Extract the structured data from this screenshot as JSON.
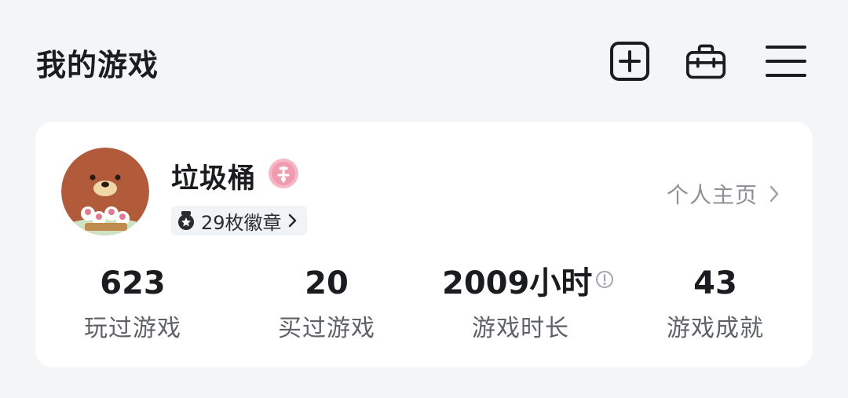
{
  "header": {
    "title": "我的游戏",
    "icons": [
      "add-icon",
      "toolbox-icon",
      "menu-icon"
    ]
  },
  "profile": {
    "username": "垃圾桶",
    "vip_badge_icon": "vip-badge-icon",
    "badges_label": "29枚徽章",
    "homepage_label": "个人主页"
  },
  "stats": [
    {
      "value": "623",
      "label": "玩过游戏"
    },
    {
      "value": "20",
      "label": "买过游戏"
    },
    {
      "value": "2009小时",
      "label": "游戏时长"
    },
    {
      "value": "43",
      "label": "游戏成就"
    }
  ],
  "colors": {
    "background": "#f4f5f7",
    "card": "#ffffff",
    "text_primary": "#1b1c1f",
    "text_secondary": "#5f6169",
    "link_gray": "#8e9098",
    "vip_pink": "#f09cb0"
  }
}
